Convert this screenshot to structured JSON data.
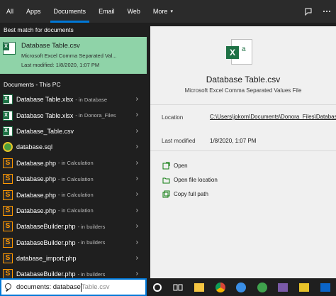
{
  "tabs": [
    {
      "label": "All",
      "active": false
    },
    {
      "label": "Apps",
      "active": false
    },
    {
      "label": "Documents",
      "active": true
    },
    {
      "label": "Email",
      "active": false
    },
    {
      "label": "Web",
      "active": false
    },
    {
      "label": "More",
      "active": false
    }
  ],
  "topbar_icons": {
    "feedback": "feedback-icon",
    "options": "more-options-icon",
    "more_caret": "▾"
  },
  "best_match": {
    "heading": "Best match for documents",
    "name": "Database Table.csv",
    "type": "Microsoft Excel Comma Separated Val...",
    "modified": "Last modified: 1/8/2020, 1:07 PM",
    "icon": "excel-file-icon"
  },
  "documents": {
    "heading": "Documents - This PC",
    "items": [
      {
        "name": "Database Table.xlsx",
        "sub": "- in Database",
        "icon": "excel"
      },
      {
        "name": "Database Table.xlsx",
        "sub": "- in Donora_Files",
        "icon": "excel"
      },
      {
        "name": "Database_Table.csv",
        "sub": "",
        "icon": "excel"
      },
      {
        "name": "database.sql",
        "sub": "",
        "icon": "sql"
      },
      {
        "name": "Database.php",
        "sub": "- in Calculation",
        "icon": "php"
      },
      {
        "name": "Database.php",
        "sub": "- in Calculation",
        "icon": "php"
      },
      {
        "name": "Database.php",
        "sub": "- in Calculation",
        "icon": "php"
      },
      {
        "name": "Database.php",
        "sub": "- in Calculation",
        "icon": "php"
      },
      {
        "name": "DatabaseBuilder.php",
        "sub": "- in builders",
        "icon": "php"
      },
      {
        "name": "DatabaseBuilder.php",
        "sub": "- in builders",
        "icon": "php"
      },
      {
        "name": "database_import.php",
        "sub": "",
        "icon": "php"
      },
      {
        "name": "DatabaseBuilder.php",
        "sub": "- in builders",
        "icon": "php"
      }
    ]
  },
  "preview": {
    "title": "Database Table.csv",
    "subtitle": "Microsoft Excel Comma Separated Values File",
    "location_label": "Location",
    "location_value": "C:\\Users\\jokorn\\Documents\\Donora_Files\\Database",
    "modified_label": "Last modified",
    "modified_value": "1/8/2020, 1:07 PM",
    "actions": [
      {
        "label": "Open",
        "icon": "open-icon"
      },
      {
        "label": "Open file location",
        "icon": "folder-icon"
      },
      {
        "label": "Copy full path",
        "icon": "copy-icon"
      }
    ]
  },
  "search": {
    "typed": "documents: database",
    "suggestion": "Table.csv"
  },
  "taskbar": {
    "items": [
      "cortana-icon",
      "task-view-icon",
      "file-explorer-icon",
      "chrome-icon",
      "edge-icon",
      "green-app-icon",
      "sql-app-icon",
      "file-manager-icon",
      "mail-icon"
    ]
  },
  "colors": {
    "accent": "#0078d7",
    "best_match_bg": "#8fd3a8",
    "excel_green": "#1e7145",
    "preview_bg": "#f0f0f0"
  }
}
